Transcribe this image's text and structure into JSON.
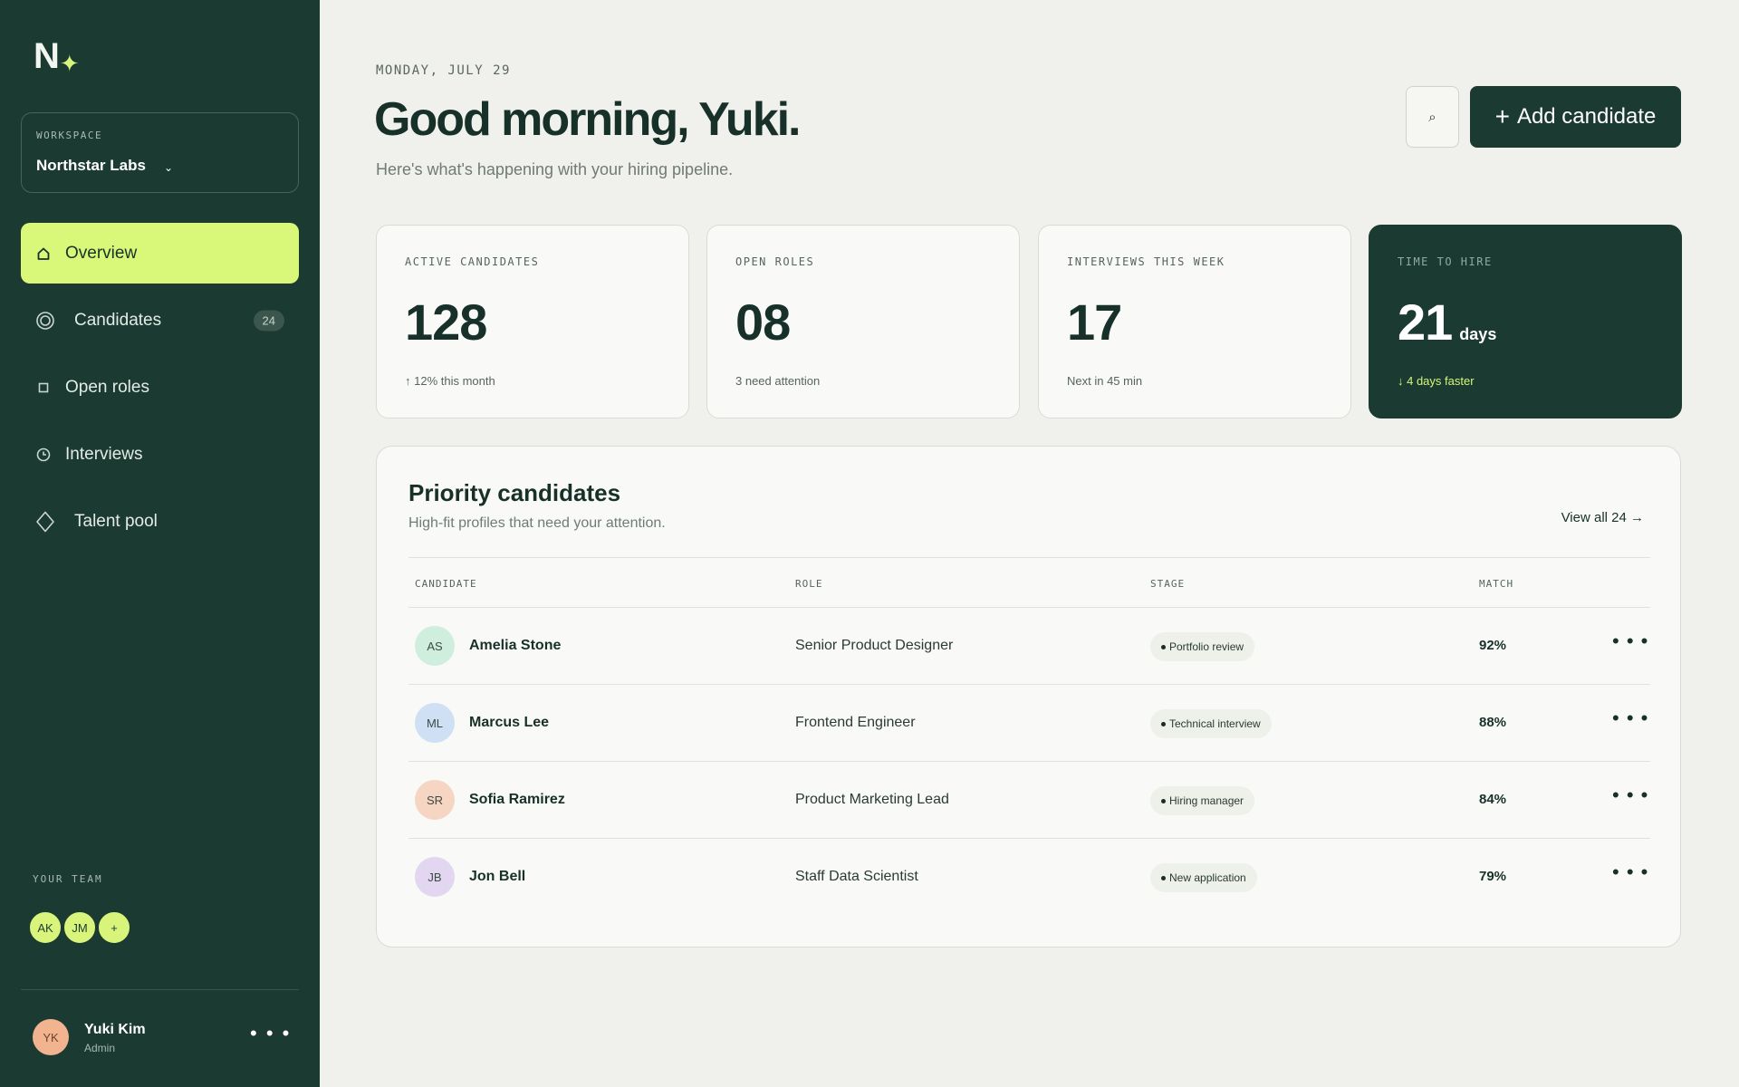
{
  "brand": {
    "logo_letter": "N",
    "logo_spark": "✦"
  },
  "workspace": {
    "label": "WORKSPACE",
    "name": "Northstar Labs",
    "caret": "⌄"
  },
  "nav": [
    {
      "label": "Overview",
      "icon": "home-icon",
      "active": true
    },
    {
      "label": "Candidates",
      "icon": "target-icon",
      "badge": "24"
    },
    {
      "label": "Open roles",
      "icon": "square-icon"
    },
    {
      "label": "Interviews",
      "icon": "clock-icon"
    },
    {
      "label": "Talent pool",
      "icon": "diamond-icon"
    }
  ],
  "team": {
    "label": "YOUR TEAM",
    "members": [
      "AK",
      "JM"
    ],
    "add": "+"
  },
  "user": {
    "initials": "YK",
    "name": "Yuki Kim",
    "role": "Admin",
    "more": "• • •"
  },
  "header": {
    "date": "MONDAY, JULY 29",
    "greeting": "Good morning, Yuki.",
    "subtitle": "Here's what's happening with your hiring pipeline.",
    "search_icon": "⌕",
    "add_plus": "+",
    "add_label": "Add candidate"
  },
  "stats": [
    {
      "label": "ACTIVE CANDIDATES",
      "value": "128",
      "unit": "",
      "note": "↑ 12% this month"
    },
    {
      "label": "OPEN ROLES",
      "value": "08",
      "unit": "",
      "note": "3 need attention"
    },
    {
      "label": "INTERVIEWS THIS WEEK",
      "value": "17",
      "unit": "",
      "note": "Next in 45 min"
    },
    {
      "label": "TIME TO HIRE",
      "value": "21",
      "unit": "days",
      "note": "↓ 4 days faster"
    }
  ],
  "priority": {
    "title": "Priority candidates",
    "subtitle": "High-fit profiles that need your attention.",
    "view_all": "View all 24 →",
    "columns": {
      "candidate": "CANDIDATE",
      "role": "ROLE",
      "stage": "STAGE",
      "match": "MATCH"
    },
    "rows": [
      {
        "initials": "AS",
        "name": "Amelia Stone",
        "role": "Senior Product Designer",
        "stage": "Portfolio review",
        "match": "92%",
        "avatar_color": "#cfeedd",
        "more": "• • •"
      },
      {
        "initials": "ML",
        "name": "Marcus Lee",
        "role": "Frontend Engineer",
        "stage": "Technical interview",
        "match": "88%",
        "avatar_color": "#cfe0f5",
        "more": "• • •"
      },
      {
        "initials": "SR",
        "name": "Sofia Ramirez",
        "role": "Product Marketing Lead",
        "stage": "Hiring manager",
        "match": "84%",
        "avatar_color": "#f6d6c2",
        "more": "• • •"
      },
      {
        "initials": "JB",
        "name": "Jon Bell",
        "role": "Staff Data Scientist",
        "stage": "New application",
        "match": "79%",
        "avatar_color": "#e2d6f1",
        "more": "• • •"
      }
    ]
  },
  "colors": {
    "sidebar": "#1b3a31",
    "accent": "#d9f779",
    "background": "#f0f1ec"
  }
}
